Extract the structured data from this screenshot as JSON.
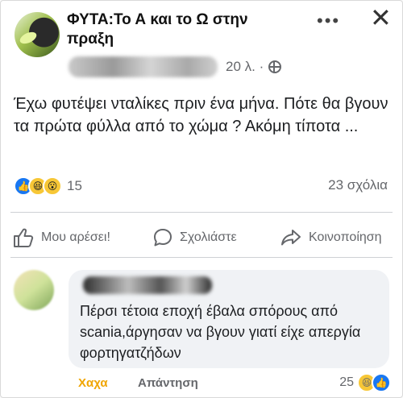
{
  "post": {
    "group_name": "ΦΥΤΑ:Το Α και το Ω στην πραξη",
    "time": "20 λ. ·",
    "text": "Έχω φυτέψει νταλίκες πριν ένα μήνα. Πότε θα βγουν τα πρώτα φύλλα από το χώμα ? Ακόμη τίποτα ...",
    "reaction_count": "15",
    "comment_count": "23 σχόλια"
  },
  "actions": {
    "like_label": "Μου αρέσει!",
    "comment_label": "Σχολιάστε",
    "share_label": "Κοινοποίηση"
  },
  "comment": {
    "text": "Πέρσι τέτοια εποχή έβαλα σπόρους από scania,άργησαν να βγουν γιατί είχε απεργία φορτηγατζήδων",
    "haha_label": "Χαχα",
    "reply_label": "Απάντηση",
    "reaction_count": "25"
  },
  "icons": {
    "more": "more-horizontal-icon",
    "close": "close-icon",
    "globe": "globe-icon",
    "like": "thumbs-up-icon",
    "comment": "comment-bubble-icon",
    "share": "share-arrow-icon"
  },
  "colors": {
    "like_blue": "#1877f2",
    "haha_yellow": "#f7c736",
    "muted_text": "#65676b",
    "bubble_bg": "#f0f2f5"
  }
}
